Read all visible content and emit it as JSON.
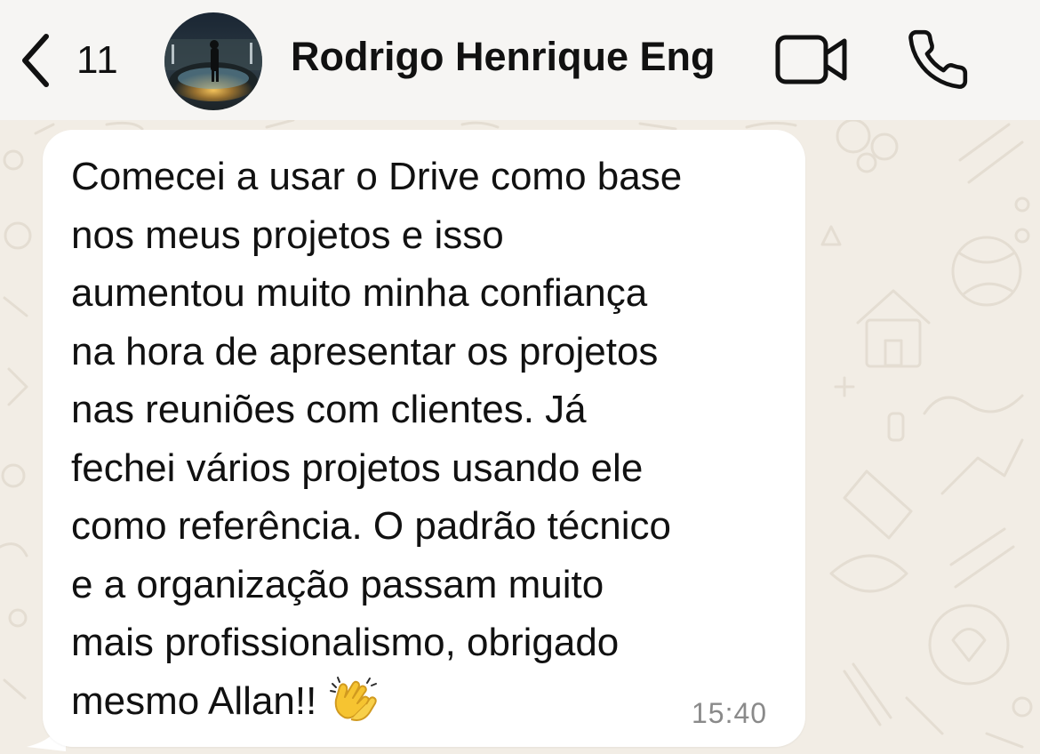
{
  "header": {
    "unread_count": "11",
    "contact_name": "Rodrigo Henrique Eng",
    "icons": {
      "back": "chevron-left-icon",
      "video_call": "video-camera-icon",
      "voice_call": "phone-icon"
    }
  },
  "message": {
    "text": "Comecei a usar o Drive como base\nnos meus projetos e isso\naumentou muito minha confiança\nna hora de apresentar os projetos\nnas reuniões com clientes. Já\nfechei vários projetos usando ele\ncomo referência. O padrão técnico\ne a organização passam muito\nmais profissionalismo, obrigado\nmesmo Allan!!",
    "emoji": "clapping-hands-emoji",
    "time": "15:40"
  },
  "colors": {
    "header_background": "#f6f5f3",
    "chat_background": "#f2ede5",
    "bubble_background": "#ffffff",
    "timestamp_text": "#8a8a8a"
  }
}
